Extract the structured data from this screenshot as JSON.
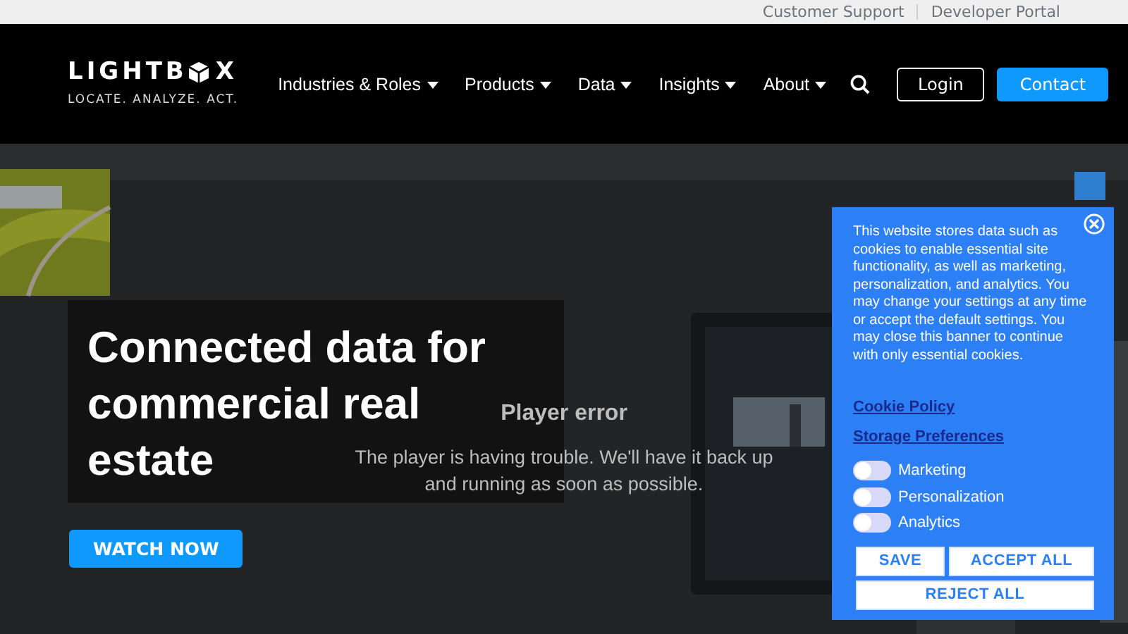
{
  "top_links": [
    {
      "label": "Customer Support"
    },
    {
      "label": "Developer Portal"
    }
  ],
  "logo": {
    "text_before": "LIGHTB",
    "text_after": "X",
    "tagline": "LOCATE. ANALYZE. ACT."
  },
  "nav": {
    "items": [
      {
        "label": "Industries & Roles",
        "dropdown": true
      },
      {
        "label": "Products",
        "dropdown": true
      },
      {
        "label": "Data",
        "dropdown": true
      },
      {
        "label": "Insights",
        "dropdown": true
      },
      {
        "label": "About",
        "dropdown": true
      }
    ],
    "login": "Login",
    "contact": "Contact"
  },
  "hero": {
    "headline_lines": [
      "Connected data for",
      "commercial real",
      "estate"
    ],
    "button": "WATCH NOW",
    "player_error": {
      "title": "Player error",
      "message": "The player is having trouble. We'll have it back up and running as soon as possible."
    }
  },
  "cookie_banner": {
    "text": "This website stores data such as cookies to enable essential site functionality, as well as marketing, personalization, and analytics. You may change your settings at any time or accept the default settings. You may close this banner to continue with only essential cookies.",
    "links": [
      "Cookie Policy",
      "Storage Preferences"
    ],
    "toggles": [
      {
        "label": "Marketing",
        "on": false
      },
      {
        "label": "Personalization",
        "on": false
      },
      {
        "label": "Analytics",
        "on": false
      }
    ],
    "buttons": [
      {
        "label": "SAVE",
        "kind": "narrow"
      },
      {
        "label": "ACCEPT ALL",
        "kind": "wide"
      },
      {
        "label": "REJECT ALL",
        "kind": "full"
      }
    ]
  }
}
